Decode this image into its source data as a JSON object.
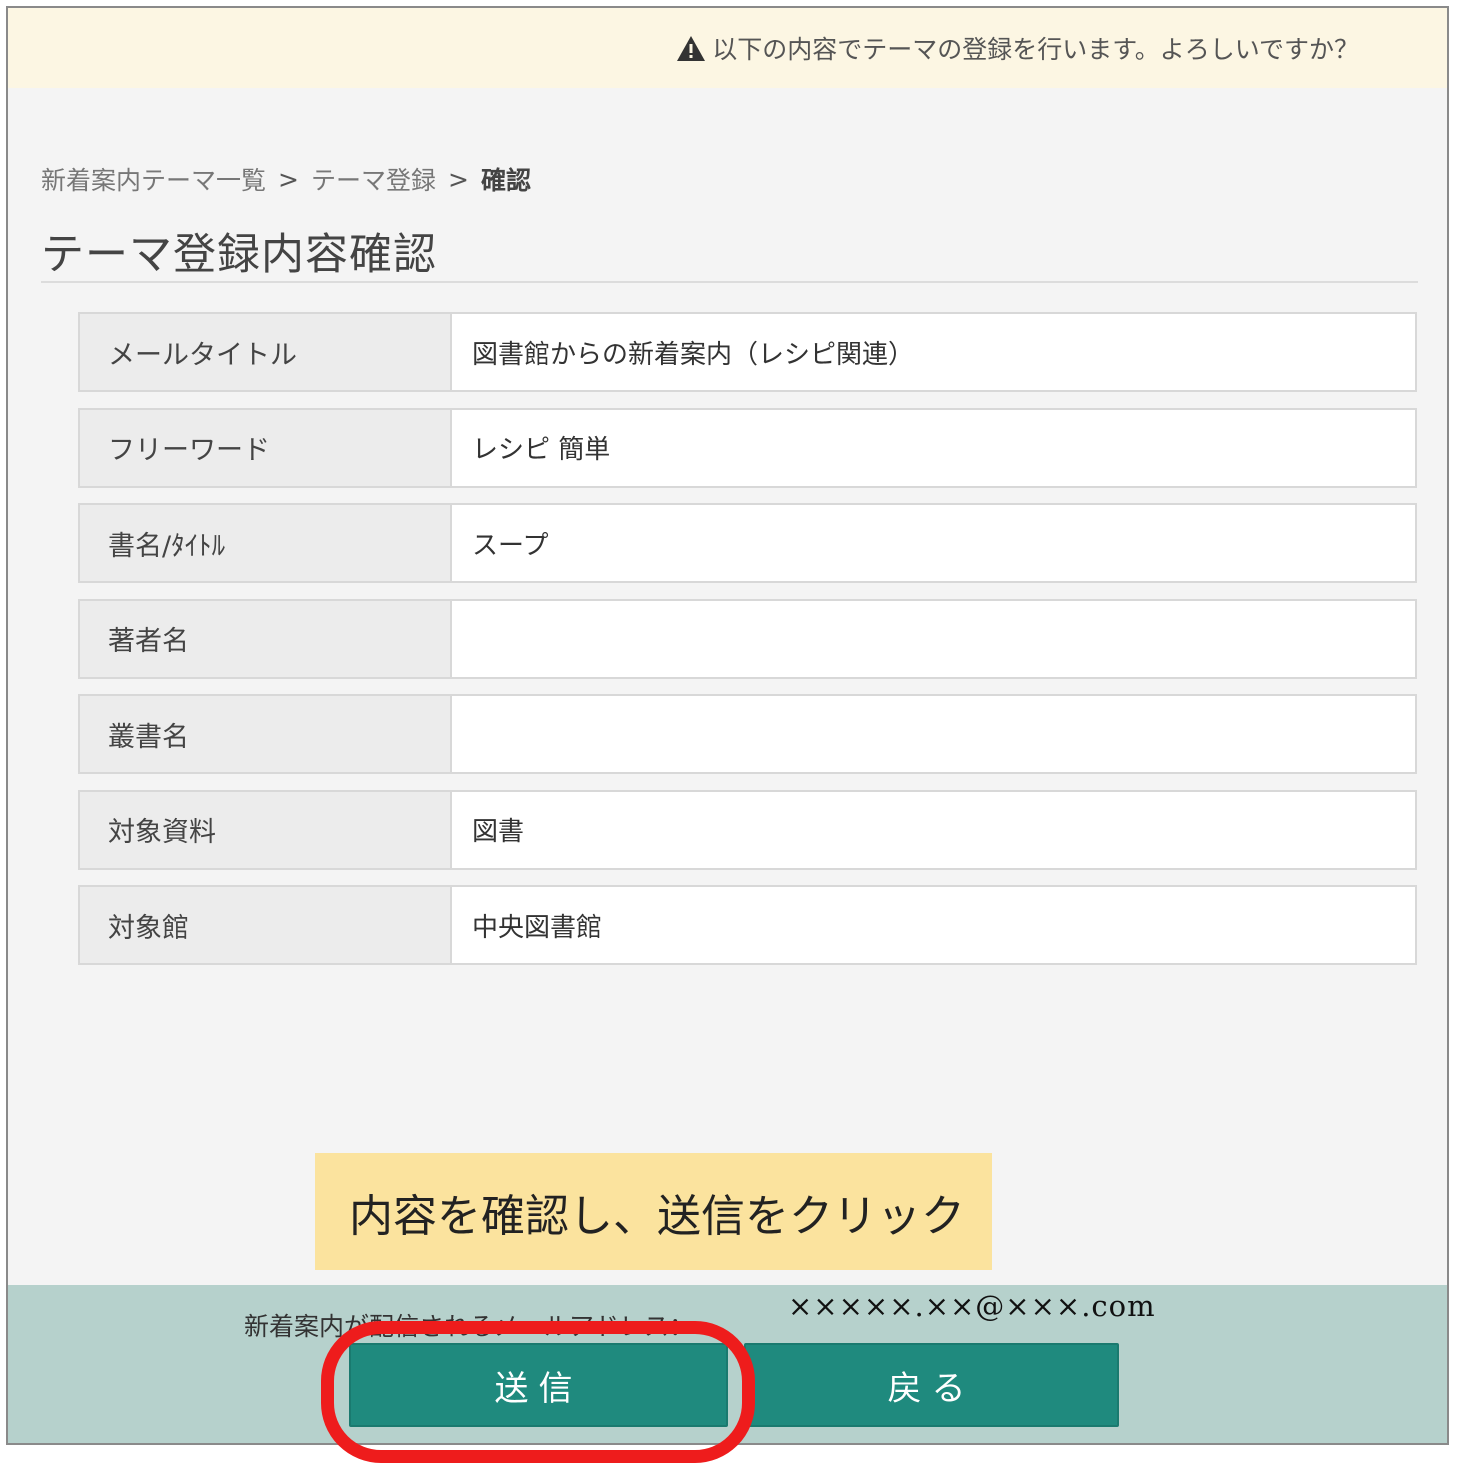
{
  "notice": {
    "icon": "warning-icon",
    "text": "以下の内容でテーマの登録を行います。よろしいですか？"
  },
  "breadcrumb": {
    "items": [
      "新着案内テーマ一覧",
      "テーマ登録",
      "確認"
    ],
    "separator": ">"
  },
  "page_title": "テーマ登録内容確認",
  "rows": [
    {
      "label": "メールタイトル",
      "value": "図書館からの新着案内（レシピ関連）"
    },
    {
      "label": "フリーワード",
      "value": "レシピ 簡単"
    },
    {
      "label": "書名/ﾀｲﾄﾙ",
      "value": "スープ"
    },
    {
      "label": "著者名",
      "value": ""
    },
    {
      "label": "叢書名",
      "value": ""
    },
    {
      "label": "対象資料",
      "value": "図書"
    },
    {
      "label": "対象館",
      "value": "中央図書館"
    }
  ],
  "hint": "内容を確認し、送信をクリック",
  "footer": {
    "mail_label": "新着案内が配信されるメールアドレス：",
    "mail_value": "×××××.××@×××.com",
    "send_label": "送信",
    "back_label": "戻る"
  },
  "colors": {
    "notice_bg": "#fcf6e3",
    "footer_bg": "#b6d1cc",
    "button": "#1f8a7e",
    "hint_bg": "#fbe39e",
    "highlight": "#ee1c1c"
  }
}
